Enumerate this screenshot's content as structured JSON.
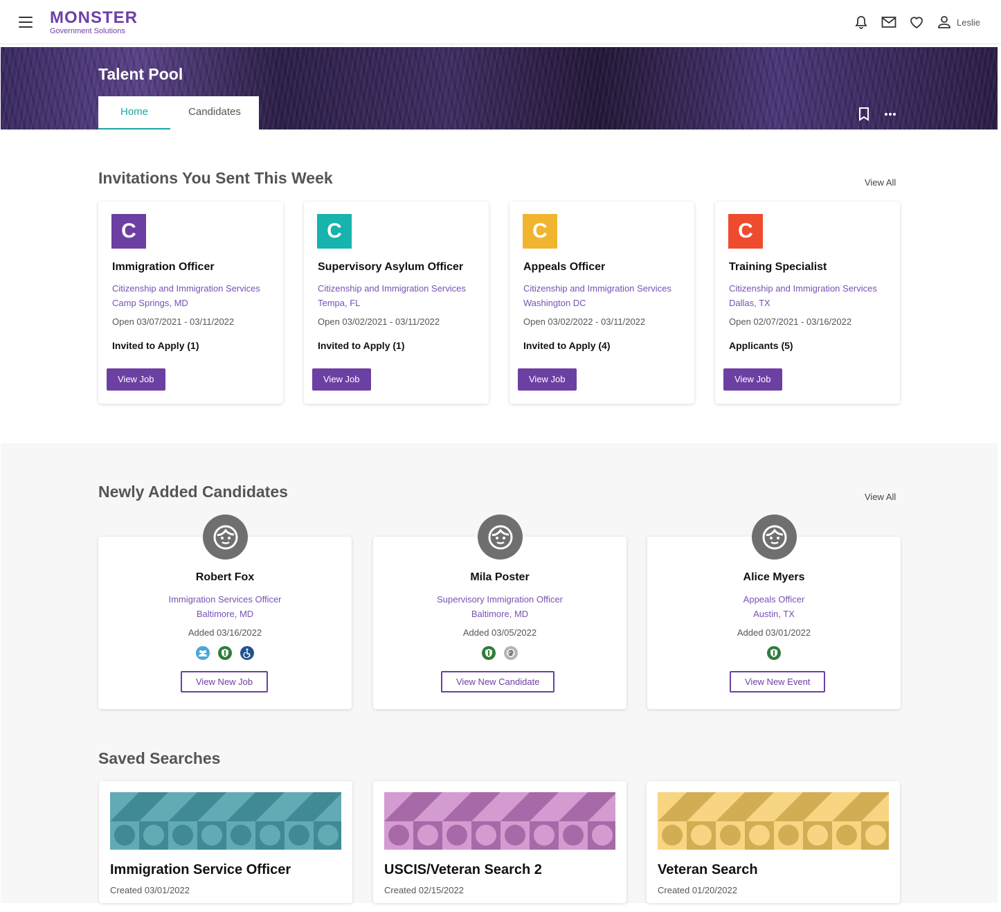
{
  "header": {
    "logo_main": "MONSTER",
    "logo_sub": "Government Solutions",
    "user_name": "Leslie",
    "icons": [
      "menu-icon",
      "bell-icon",
      "mail-icon",
      "heart-icon",
      "user-icon"
    ]
  },
  "banner": {
    "title": "Talent Pool",
    "tabs": [
      {
        "label": "Home",
        "active": true
      },
      {
        "label": "Candidates",
        "active": false
      }
    ]
  },
  "invitations": {
    "title": "Invitations You Sent This Week",
    "view_all": "View All",
    "cards": [
      {
        "letter": "C",
        "color": "#6c3fa3",
        "title": "Immigration Officer",
        "agency": "Citizenship and Immigration Services",
        "location": "Camp Springs, MD",
        "open": "Open 03/07/2021 - 03/11/2022",
        "status": "Invited to Apply (1)",
        "button": "View Job"
      },
      {
        "letter": "C",
        "color": "#17b3ad",
        "title": "Supervisory Asylum Officer",
        "agency": "Citizenship and Immigration Services",
        "location": "Tempa, FL",
        "open": "Open 03/02/2021 - 03/11/2022",
        "status": "Invited to Apply (1)",
        "button": "View Job"
      },
      {
        "letter": "C",
        "color": "#f1b42f",
        "title": "Appeals Officer",
        "agency": "Citizenship and Immigration Services",
        "location": "Washington DC",
        "open": "Open 03/02/2022 - 03/11/2022",
        "status": "Invited to Apply (4)",
        "button": "View Job"
      },
      {
        "letter": "C",
        "color": "#ef4b2f",
        "title": "Training Specialist",
        "agency": "Citizenship and Immigration Services",
        "location": "Dallas, TX",
        "open": "Open 02/07/2021 - 03/16/2022",
        "status": "Applicants (5)",
        "button": "View Job"
      }
    ]
  },
  "candidates": {
    "title": "Newly Added Candidates",
    "view_all": "View All",
    "cards": [
      {
        "name": "Robert Fox",
        "role": "Immigration Services Officer",
        "location": "Baltimore, MD",
        "added": "Added 03/16/2022",
        "badges": [
          "group-badge-icon",
          "veteran-badge-icon",
          "accessibility-badge-icon"
        ],
        "button": "View New Job"
      },
      {
        "name": "Mila Poster",
        "role": "Supervisory Immigration Officer",
        "location": "Baltimore, MD",
        "added": "Added 03/05/2022",
        "badges": [
          "veteran-badge-icon",
          "number-two-badge-icon"
        ],
        "button": "View New Candidate"
      },
      {
        "name": "Alice Myers",
        "role": "Appeals Officer",
        "location": "Austin, TX",
        "added": "Added 03/01/2022",
        "badges": [
          "veteran-badge-icon"
        ],
        "button": "View New Event"
      }
    ]
  },
  "saved_searches": {
    "title": "Saved Searches",
    "cards": [
      {
        "title": "Immigration Service Officer",
        "created": "Created 03/01/2022",
        "light": "#62abb4",
        "dark": "#3f8a94"
      },
      {
        "title": "USCIS/Veteran Search 2",
        "created": "Created 02/15/2022",
        "light": "#d49bd1",
        "dark": "#a869a8"
      },
      {
        "title": "Veteran Search",
        "created": "Created 01/20/2022",
        "light": "#f7d582",
        "dark": "#d3ad53"
      }
    ]
  }
}
